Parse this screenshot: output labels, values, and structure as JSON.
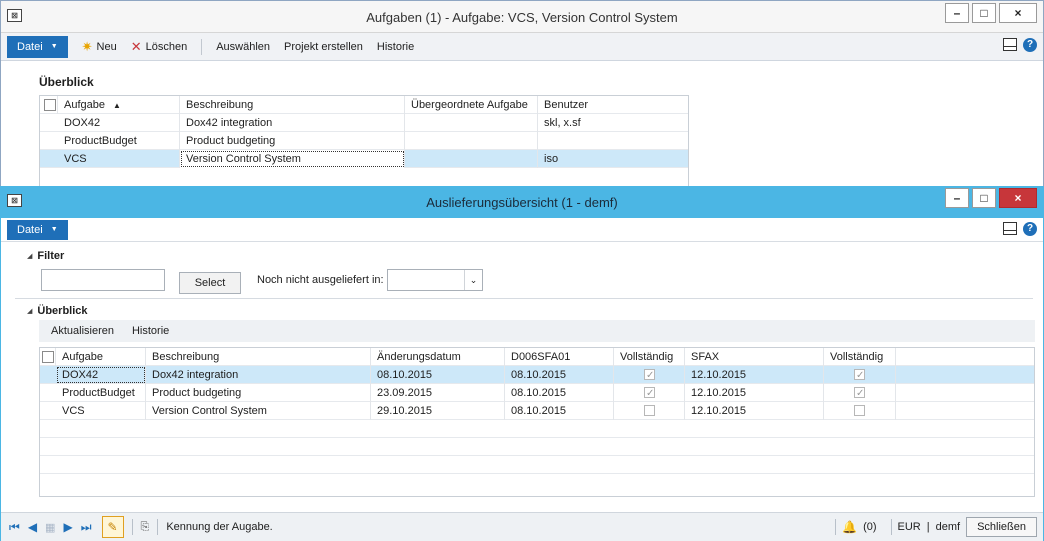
{
  "win1": {
    "title": "Aufgaben (1) - Aufgabe: VCS, Version Control System",
    "toolbar": {
      "datei": "Datei",
      "neu": "Neu",
      "loeschen": "Löschen",
      "auswaehlen": "Auswählen",
      "projekt": "Projekt erstellen",
      "historie": "Historie"
    },
    "section": "Überblick",
    "columns": [
      "Aufgabe",
      "Beschreibung",
      "Übergeordnete Aufgabe",
      "Benutzer"
    ],
    "rows": [
      {
        "aufgabe": "DOX42",
        "beschreibung": "Dox42 integration",
        "parent": "",
        "benutzer": "skl, x.sf"
      },
      {
        "aufgabe": "ProductBudget",
        "beschreibung": "Product budgeting",
        "parent": "",
        "benutzer": ""
      },
      {
        "aufgabe": "VCS",
        "beschreibung": "Version Control System",
        "parent": "",
        "benutzer": "iso"
      }
    ]
  },
  "win2": {
    "title": "Auslieferungsübersicht (1 - demf)",
    "datei": "Datei",
    "filter": {
      "title": "Filter",
      "select_label": "Select",
      "not_delivered_label": "Noch nicht ausgeliefert in:"
    },
    "overview": {
      "title": "Überblick",
      "aktualisieren": "Aktualisieren",
      "historie": "Historie",
      "columns": [
        "Aufgabe",
        "Beschreibung",
        "Änderungsdatum",
        "D006SFA01",
        "Vollständig",
        "SFAX",
        "Vollständig"
      ],
      "rows": [
        {
          "aufgabe": "DOX42",
          "beschreibung": "Dox42 integration",
          "datum": "08.10.2015",
          "d006": "08.10.2015",
          "voll1": true,
          "sfax": "12.10.2015",
          "voll2": true
        },
        {
          "aufgabe": "ProductBudget",
          "beschreibung": "Product budgeting",
          "datum": "23.09.2015",
          "d006": "08.10.2015",
          "voll1": true,
          "sfax": "12.10.2015",
          "voll2": true
        },
        {
          "aufgabe": "VCS",
          "beschreibung": "Version Control System",
          "datum": "29.10.2015",
          "d006": "08.10.2015",
          "voll1": false,
          "sfax": "12.10.2015",
          "voll2": false
        }
      ]
    },
    "status": {
      "text": "Kennung der Augabe.",
      "notifications": "(0)",
      "currency": "EUR",
      "company": "demf",
      "close": "Schließen"
    }
  },
  "colors": {
    "accent": "#1f6fb8",
    "active_titlebar": "#4bb6e4",
    "selection": "#cde8f9",
    "close_red": "#c7363a"
  }
}
